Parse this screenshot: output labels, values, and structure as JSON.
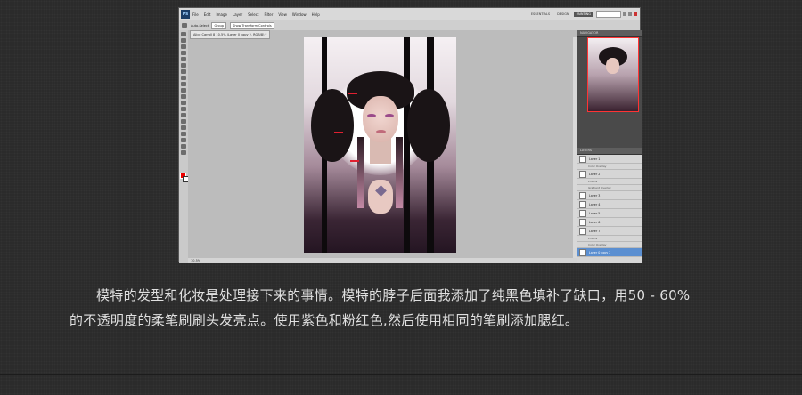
{
  "app": {
    "logo": "Ps",
    "menus": [
      "File",
      "Edit",
      "Image",
      "Layer",
      "Select",
      "Filter",
      "View",
      "Window",
      "Help"
    ],
    "workspaces": [
      "ESSENTIALS",
      "DESIGN",
      "PAINTING"
    ],
    "active_workspace": "PAINTING",
    "options": {
      "auto_select": "Auto-Select:",
      "group": "Group",
      "transform_controls": "Show Transform Controls"
    },
    "document_tab": "Alice Carroll 8 10.5% (Layer 0 copy 2, RGB/8) *",
    "status": "10.5%",
    "panels": {
      "navigator_tab": "NAVIGATOR",
      "layers_tab": "LAYERS"
    },
    "layers": [
      {
        "name": "Layer 1",
        "sub": "Effects"
      },
      {
        "name": "Color Overlay",
        "is_sub": true
      },
      {
        "name": "Layer 2"
      },
      {
        "name": "Effects",
        "is_sub": true
      },
      {
        "name": "Gradient Overlay",
        "is_sub": true
      },
      {
        "name": "Layer 3"
      },
      {
        "name": "Layer 4"
      },
      {
        "name": "Layer 5"
      },
      {
        "name": "Layer 6"
      },
      {
        "name": "Layer 7"
      },
      {
        "name": "Effects",
        "is_sub": true
      },
      {
        "name": "Color Overlay",
        "is_sub": true
      },
      {
        "name": "Layer 0 copy 2",
        "selected": true
      }
    ],
    "colors": {
      "foreground": "#ee0000",
      "background": "#ffffff",
      "accent": "#5b8fd1"
    }
  },
  "caption": {
    "line1": "模特的发型和化妆是处理接下来的事情。模特的脖子后面我添加了纯黑色填补了缺口，用50 - 60%",
    "line2": "的不透明度的柔笔刷刷头发亮点。使用紫色和粉红色,然后使用相同的笔刷添加腮红。"
  }
}
